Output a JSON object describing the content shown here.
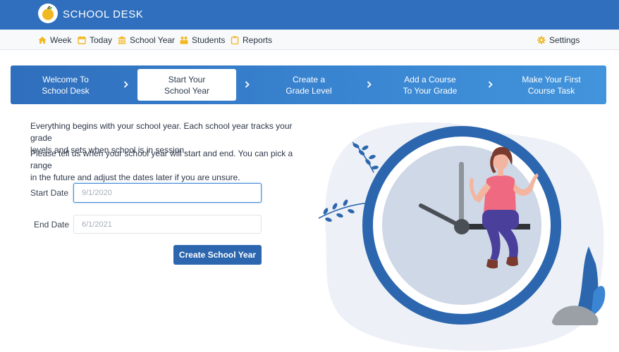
{
  "app": {
    "brand": "SCHOOL DESK"
  },
  "nav": {
    "items": [
      {
        "label": "Week",
        "icon": "home-icon"
      },
      {
        "label": "Today",
        "icon": "calendar-icon"
      },
      {
        "label": "School Year",
        "icon": "school-icon"
      },
      {
        "label": "Students",
        "icon": "students-icon"
      },
      {
        "label": "Reports",
        "icon": "clipboard-icon"
      }
    ],
    "settings": {
      "label": "Settings",
      "icon": "gear-icon"
    }
  },
  "colors": {
    "primary": "#2f6fbd",
    "accent": "#f2b821",
    "button": "#2c66ae"
  },
  "steps": [
    {
      "label": "Welcome To\nSchool Desk",
      "active": false
    },
    {
      "label": "Start Your\nSchool Year",
      "active": true
    },
    {
      "label": "Create a\nGrade Level",
      "active": false
    },
    {
      "label": "Add a Course\nTo Your Grade",
      "active": false
    },
    {
      "label": "Make Your First\nCourse Task",
      "active": false
    }
  ],
  "intro": {
    "line1": "Everything begins with your school year. Each school year tracks your grade",
    "line2": "levels and sets when school is in session.",
    "line3": "Please tell us when your school year will start and end. You can pick a range",
    "line4": "in the future and adjust the dates later if you are unsure."
  },
  "form": {
    "start_label": "Start Date",
    "start_placeholder": "9/1/2020",
    "end_label": "End Date",
    "end_placeholder": "6/1/2021",
    "submit_label": "Create School Year"
  }
}
